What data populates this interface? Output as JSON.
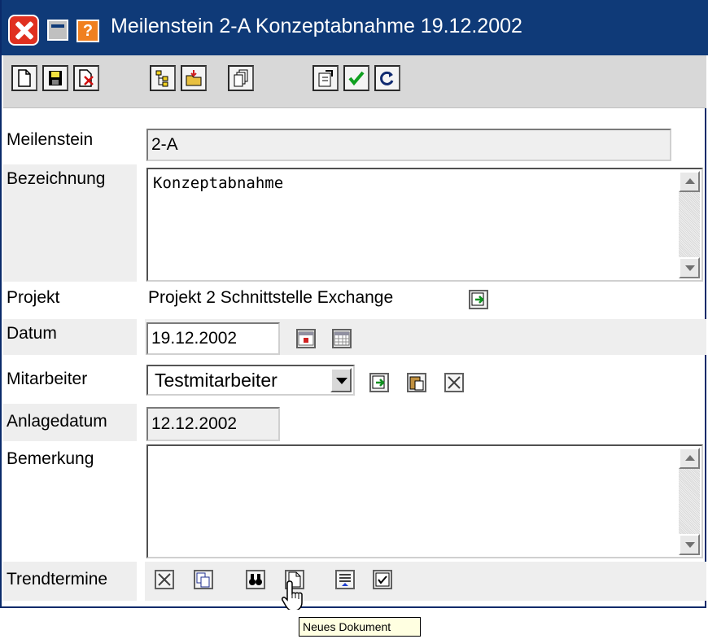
{
  "window": {
    "title": "Meilenstein 2-A Konzeptabnahme 19.12.2002",
    "titlebar_color": "#0f3a78"
  },
  "titlebar_icons": [
    "close-icon",
    "minimize-icon",
    "help-icon"
  ],
  "toolbar": {
    "buttons": [
      {
        "name": "new-document-icon"
      },
      {
        "name": "save-icon"
      },
      {
        "name": "delete-icon"
      },
      {
        "name": "tree-icon"
      },
      {
        "name": "open-folder-icon"
      },
      {
        "name": "copy-icon"
      },
      {
        "name": "properties-icon"
      },
      {
        "name": "checkmark-icon"
      },
      {
        "name": "refresh-icon"
      }
    ]
  },
  "form": {
    "meilenstein": {
      "label": "Meilenstein",
      "value": "2-A"
    },
    "bezeichnung": {
      "label": "Bezeichnung",
      "value": "Konzeptabnahme"
    },
    "projekt": {
      "label": "Projekt",
      "value": "Projekt 2 Schnittstelle Exchange"
    },
    "datum": {
      "label": "Datum",
      "value": "19.12.2002"
    },
    "mitarbeiter": {
      "label": "Mitarbeiter",
      "value": "Testmitarbeiter"
    },
    "anlagedatum": {
      "label": "Anlagedatum",
      "value": "12.12.2002"
    },
    "bemerkung": {
      "label": "Bemerkung",
      "value": ""
    },
    "trendtermine": {
      "label": "Trendtermine"
    }
  },
  "tooltip": {
    "text": "Neues Dokument"
  }
}
